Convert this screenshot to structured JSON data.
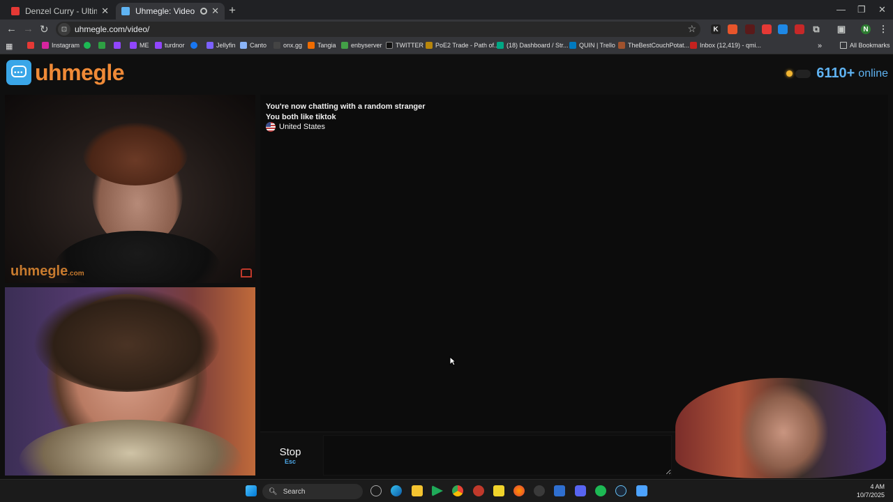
{
  "browser": {
    "tabs": [
      {
        "title": "Denzel Curry - Ultimate (BADB",
        "favicon_color": "#e53935",
        "active": false
      },
      {
        "title": "Uhmegle: Video Chat | Ome",
        "favicon_color": "#5fb3f2",
        "active": true
      }
    ],
    "url": "uhmegle.com/video/",
    "bookmarks": [
      {
        "label": "",
        "icon_color": "#e53935"
      },
      {
        "label": "Instagram",
        "icon_color": "#d6249f"
      },
      {
        "label": "",
        "icon_color": "#1db954"
      },
      {
        "label": "",
        "icon_color": "#2ea043"
      },
      {
        "label": "",
        "icon_color": "#9146ff"
      },
      {
        "label": "ME",
        "icon_color": "#9146ff"
      },
      {
        "label": "turdnor",
        "icon_color": "#9146ff"
      },
      {
        "label": "",
        "icon_color": "#1877f2"
      },
      {
        "label": "Jellyfin",
        "icon_color": "#7b61ff"
      },
      {
        "label": "Canto",
        "icon_color": "#8ab4f8"
      },
      {
        "label": "onx.gg",
        "icon_color": "#444"
      },
      {
        "label": "Tangia",
        "icon_color": "#ef6c00"
      },
      {
        "label": "enbyserver",
        "icon_color": "#43a047"
      },
      {
        "label": "TWITTER",
        "icon_color": "#111"
      },
      {
        "label": "PoE2 Trade - Path of...",
        "icon_color": "#b8860b"
      },
      {
        "label": "(18) Dashboard / Str...",
        "icon_color": "#00a884"
      },
      {
        "label": "QUIN | Trello",
        "icon_color": "#0079bf"
      },
      {
        "label": "TheBestCouchPotat...",
        "icon_color": "#a0522d"
      },
      {
        "label": "Inbox (12,419) - qmi...",
        "icon_color": "#c5221f"
      }
    ],
    "all_bookmarks_label": "All Bookmarks"
  },
  "site": {
    "logo_text": "uhmegle",
    "online_count": "6110+",
    "online_label": "online",
    "watermark": "uhmegle",
    "watermark_suffix": ".com"
  },
  "chat": {
    "status_line": "You're now chatting with a random stranger",
    "interests_line": "You both like tiktok",
    "country": "United States"
  },
  "controls": {
    "stop_label": "Stop",
    "stop_key": "Esc"
  },
  "taskbar": {
    "search_label": "Search",
    "clock_time": "4 AM",
    "clock_date": "10/7/2025"
  },
  "colors": {
    "brand_orange": "#ef8a37",
    "brand_blue": "#5fb3f2",
    "online_dot": "#f2b531"
  }
}
